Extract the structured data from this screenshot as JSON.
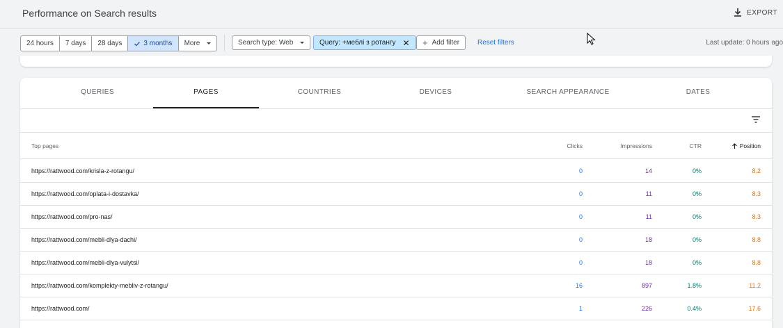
{
  "header": {
    "title": "Performance on Search results",
    "export_label": "EXPORT"
  },
  "filters": {
    "date_ranges": [
      "24 hours",
      "7 days",
      "28 days",
      "3 months",
      "More"
    ],
    "active_range": "3 months",
    "search_type": "Search type: Web",
    "query_chip": "Query: +меблі з ротангу",
    "add_filter": "Add filter",
    "reset": "Reset filters",
    "last_update": "Last update: 0 hours ago"
  },
  "tabs": [
    "QUERIES",
    "PAGES",
    "COUNTRIES",
    "DEVICES",
    "SEARCH APPEARANCE",
    "DATES"
  ],
  "active_tab": "PAGES",
  "table": {
    "headers": {
      "page": "Top pages",
      "clicks": "Clicks",
      "impressions": "Impressions",
      "ctr": "CTR",
      "position": "Position"
    },
    "sort_column": "Position",
    "rows": [
      {
        "url": "https://rattwood.com/krisla-z-rotangu/",
        "clicks": "0",
        "impressions": "14",
        "ctr": "0%",
        "position": "8.2"
      },
      {
        "url": "https://rattwood.com/oplata-i-dostavka/",
        "clicks": "0",
        "impressions": "11",
        "ctr": "0%",
        "position": "8.3"
      },
      {
        "url": "https://rattwood.com/pro-nas/",
        "clicks": "0",
        "impressions": "11",
        "ctr": "0%",
        "position": "8.3"
      },
      {
        "url": "https://rattwood.com/mebli-dlya-dachi/",
        "clicks": "0",
        "impressions": "18",
        "ctr": "0%",
        "position": "8.8"
      },
      {
        "url": "https://rattwood.com/mebli-dlya-vulytsi/",
        "clicks": "0",
        "impressions": "18",
        "ctr": "0%",
        "position": "8.8"
      },
      {
        "url": "https://rattwood.com/komplekty-mebliv-z-rotangu/",
        "clicks": "16",
        "impressions": "897",
        "ctr": "1.8%",
        "position": "11.2"
      },
      {
        "url": "https://rattwood.com/",
        "clicks": "1",
        "impressions": "226",
        "ctr": "0.4%",
        "position": "17.6"
      }
    ]
  },
  "colors": {
    "clicks": "#1a73e8",
    "impressions": "#6f2da8",
    "ctr": "#00796b",
    "position": "#e8710a",
    "active_chip": "#c2e7ff"
  }
}
